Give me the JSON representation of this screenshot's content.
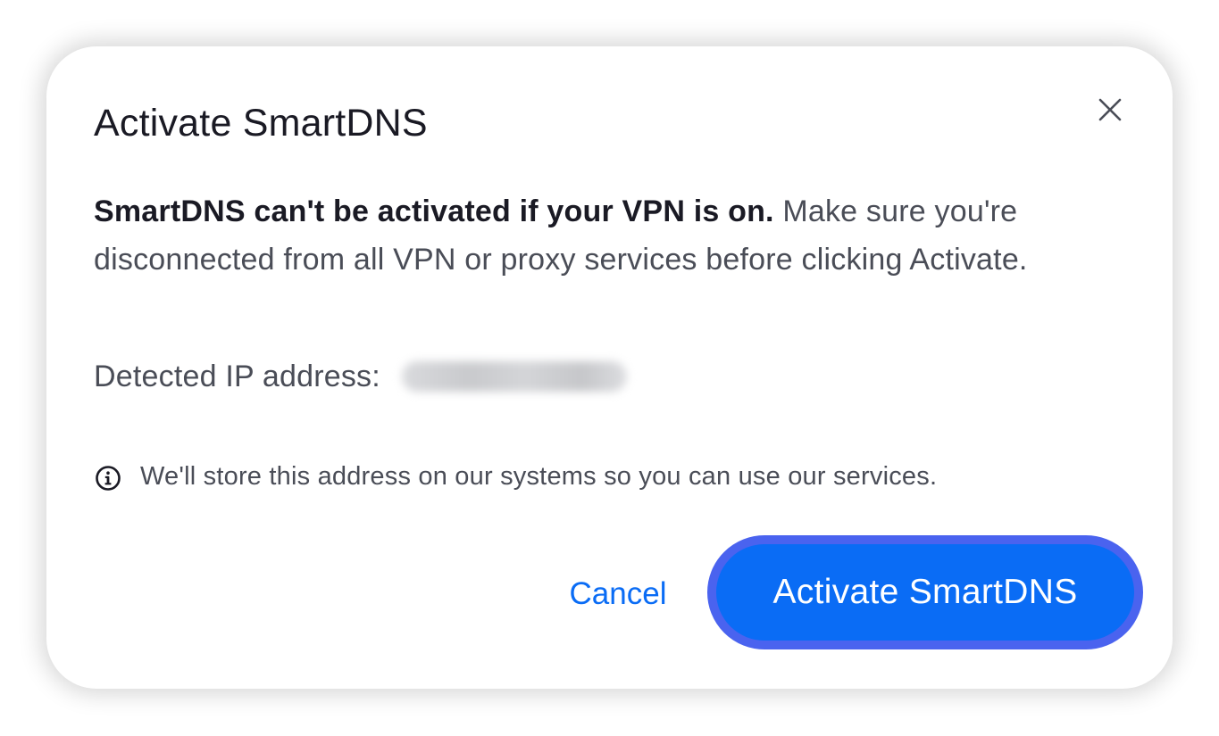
{
  "dialog": {
    "title": "Activate SmartDNS",
    "close_icon": "close-icon",
    "message_bold": "SmartDNS can't be activated if your VPN is on.",
    "message_rest": " Make sure you're disconnected from all VPN or proxy services before clicking Activate.",
    "ip_label": "Detected IP address:",
    "info_icon": "info-icon",
    "info_text": "We'll store this address on our systems so you can use our services.",
    "cancel_label": "Cancel",
    "activate_label": "Activate SmartDNS"
  },
  "colors": {
    "primary": "#0a6cf5",
    "primary_border": "#4a63ef",
    "title_text": "#1a1a24",
    "body_text": "#4a4d57"
  }
}
